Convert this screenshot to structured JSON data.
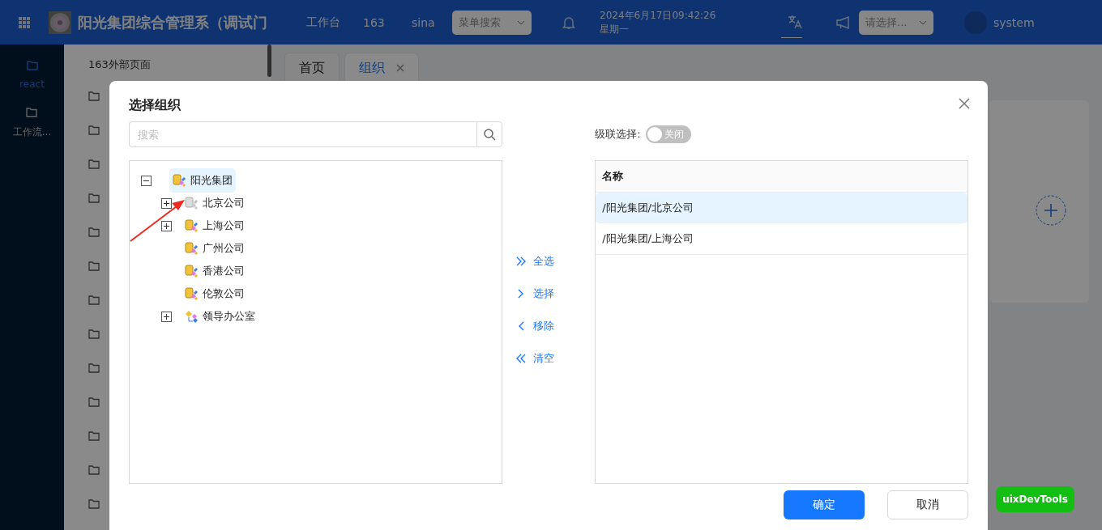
{
  "header": {
    "title": "阳光集团综合管理系（调试门",
    "workbench": "工作台",
    "links": [
      "163",
      "sina"
    ],
    "menu_search": {
      "placeholder": "菜单搜索"
    },
    "date": "2024年6月17日09:42:26",
    "weekday": "星期一",
    "lang_select": {
      "placeholder": "请选择..."
    },
    "user": "system"
  },
  "sidebar": {
    "items": [
      {
        "label": "react",
        "selected": true
      },
      {
        "label": "工作流...",
        "selected": false
      }
    ]
  },
  "subsidebar": {
    "title": "163外部页面"
  },
  "tabs": [
    {
      "label": "首页",
      "selected": false,
      "closable": false
    },
    {
      "label": "组织",
      "selected": true,
      "closable": true
    }
  ],
  "dialog": {
    "title": "选择组织",
    "search": {
      "placeholder": "搜索"
    },
    "tree": [
      {
        "label": "阳光集团",
        "kind": "group",
        "expanded": true,
        "selected": true,
        "dimmed": false,
        "children": [
          {
            "label": "北京公司",
            "kind": "company",
            "expanded": false,
            "selected": false,
            "dimmed": true
          },
          {
            "label": "上海公司",
            "kind": "company",
            "expanded": false,
            "selected": false,
            "dimmed": false
          },
          {
            "label": "广州公司",
            "kind": "company",
            "selected": false,
            "dimmed": false
          },
          {
            "label": "香港公司",
            "kind": "company",
            "selected": false,
            "dimmed": false
          },
          {
            "label": "伦敦公司",
            "kind": "company",
            "selected": false,
            "dimmed": false
          },
          {
            "label": "领导办公室",
            "kind": "office",
            "expanded": false,
            "selected": false,
            "dimmed": false
          }
        ]
      }
    ],
    "actions": [
      {
        "kind": "all",
        "label": "全选"
      },
      {
        "kind": "add",
        "label": "选择"
      },
      {
        "kind": "remove",
        "label": "移除"
      },
      {
        "kind": "clear",
        "label": "清空"
      }
    ],
    "cascade": {
      "label": "级联选择:",
      "on": false,
      "text": "关闭"
    },
    "table": {
      "columns": [
        "名称"
      ],
      "rows": [
        {
          "name": "/阳光集团/北京公司",
          "selected": true
        },
        {
          "name": "/阳光集团/上海公司",
          "selected": false
        }
      ]
    },
    "buttons": [
      {
        "kind": "primary",
        "label": "确定"
      },
      {
        "kind": "default",
        "label": "取消"
      }
    ]
  },
  "devtools": "uixDevTools"
}
